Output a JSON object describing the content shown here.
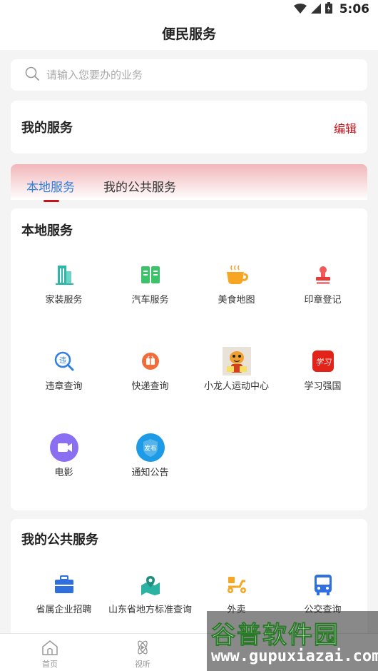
{
  "status_bar": {
    "time": "5:06"
  },
  "header": {
    "title": "便民服务"
  },
  "search": {
    "placeholder": "请输入您要办的业务"
  },
  "my_services": {
    "title": "我的服务",
    "edit_label": "编辑"
  },
  "tabs": [
    {
      "label": "本地服务",
      "active": true
    },
    {
      "label": "我的公共服务",
      "active": false
    }
  ],
  "local_services": {
    "title": "本地服务",
    "items": [
      {
        "label": "家装服务",
        "icon": "building-icon"
      },
      {
        "label": "汽车服务",
        "icon": "book-icon"
      },
      {
        "label": "美食地图",
        "icon": "coffee-cup-icon"
      },
      {
        "label": "印章登记",
        "icon": "stamp-icon"
      },
      {
        "label": "违章查询",
        "icon": "violation-search-icon"
      },
      {
        "label": "快递查询",
        "icon": "express-package-icon"
      },
      {
        "label": "小龙人运动中心",
        "icon": "tiger-photo-icon"
      },
      {
        "label": "学习强国",
        "icon": "xuexi-app-icon"
      },
      {
        "label": "电影",
        "icon": "video-camera-icon"
      },
      {
        "label": "通知公告",
        "icon": "announcement-shield-icon"
      }
    ]
  },
  "public_services": {
    "title": "我的公共服务",
    "items": [
      {
        "label": "省属企业招聘",
        "icon": "briefcase-icon"
      },
      {
        "label": "山东省地方标准查询",
        "icon": "map-pin-icon"
      },
      {
        "label": "外卖",
        "icon": "scooter-icon"
      },
      {
        "label": "公交查询",
        "icon": "bus-icon"
      }
    ]
  },
  "bottom_nav": [
    {
      "label": "首页",
      "icon": "home-icon"
    },
    {
      "label": "视听",
      "icon": "atom-play-icon"
    }
  ],
  "watermark": {
    "title": "谷普软件园",
    "url": "www.gupuxiazai.com"
  },
  "colors": {
    "accent_red": "#c8131b",
    "accent_blue": "#2f7fe0"
  }
}
